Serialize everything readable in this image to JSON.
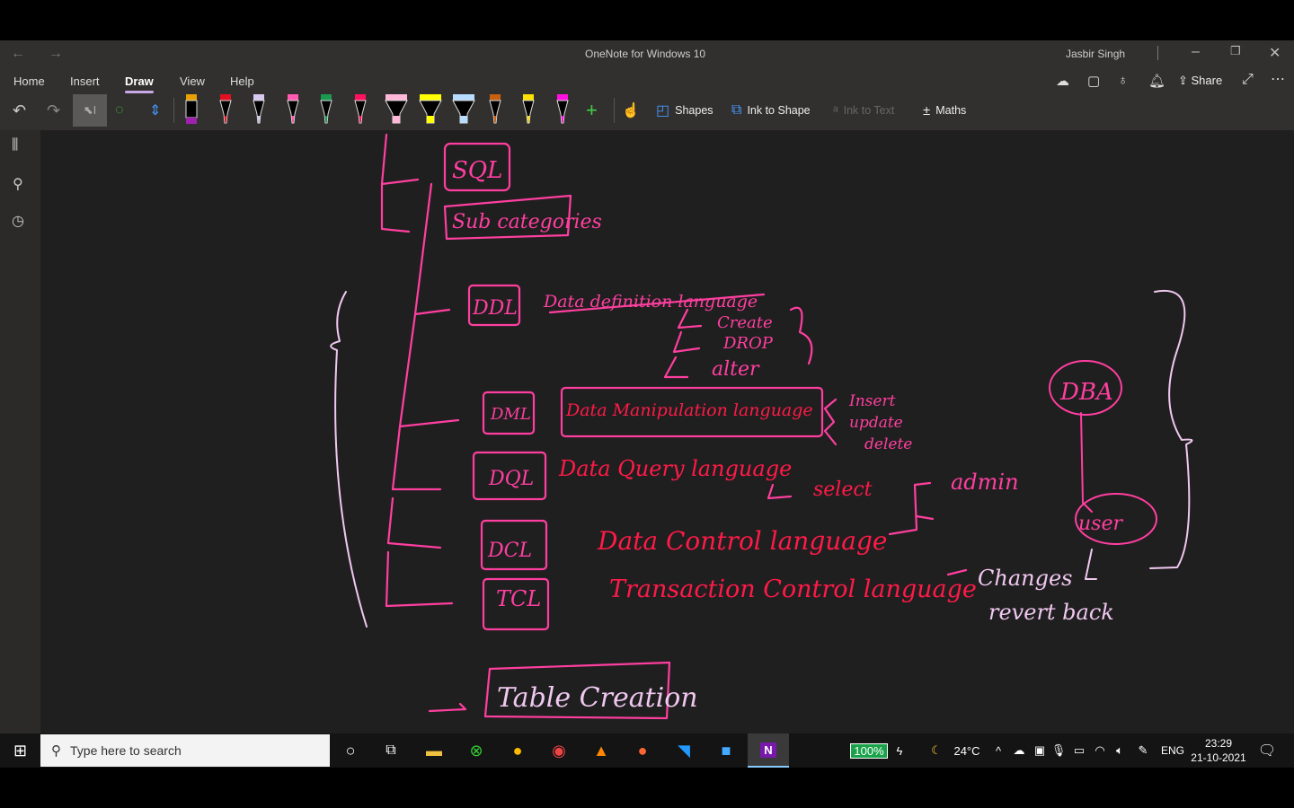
{
  "window": {
    "title": "OneNote for Windows 10",
    "user": "Jasbir Singh"
  },
  "tabs": [
    {
      "label": "Home"
    },
    {
      "label": "Insert"
    },
    {
      "label": "Draw",
      "active": true
    },
    {
      "label": "View"
    },
    {
      "label": "Help"
    }
  ],
  "header_actions": {
    "share": "Share"
  },
  "toolbar": {
    "shapes": "Shapes",
    "ink_to_shape": "Ink to Shape",
    "ink_to_text": "Ink to Text",
    "maths": "Maths"
  },
  "pens": [
    "#e8a000",
    "#e01020",
    "#d8c8f0",
    "#ff5ab0",
    "#1a9a50",
    "#ff1060",
    "#ffb8d8",
    "#ffff00",
    "#b8dcff",
    "#c86010",
    "#ffe000",
    "#ff10e0"
  ],
  "ink": {
    "pink": "#ff3fa0",
    "red": "#ff1a48",
    "light": "#f0c8f0",
    "sql": "SQL",
    "subcategories": "Sub categories",
    "ddl": "DDL",
    "ddl_desc": "Data definition language",
    "create": "Create",
    "drop": "DROP",
    "alter": "alter",
    "dml": "DML",
    "dml_desc": "Data Manipulation language",
    "insert": "Insert",
    "update": "update",
    "delete": "delete",
    "dql": "DQL",
    "dql_desc": "Data Query language",
    "select": "select",
    "dcl": "DCL",
    "dcl_desc": "Data Control language",
    "admin": "admin",
    "tcl": "TCL",
    "tcl_desc": "Transaction Control language",
    "changes": "Changes",
    "revert": "revert back",
    "dba": "DBA",
    "user": "user",
    "table": "Table Creation"
  },
  "taskbar": {
    "search_placeholder": "Type here to search",
    "battery": "100%",
    "temperature": "24°C",
    "language": "ENG",
    "time": "23:29",
    "date": "21-10-2021"
  }
}
